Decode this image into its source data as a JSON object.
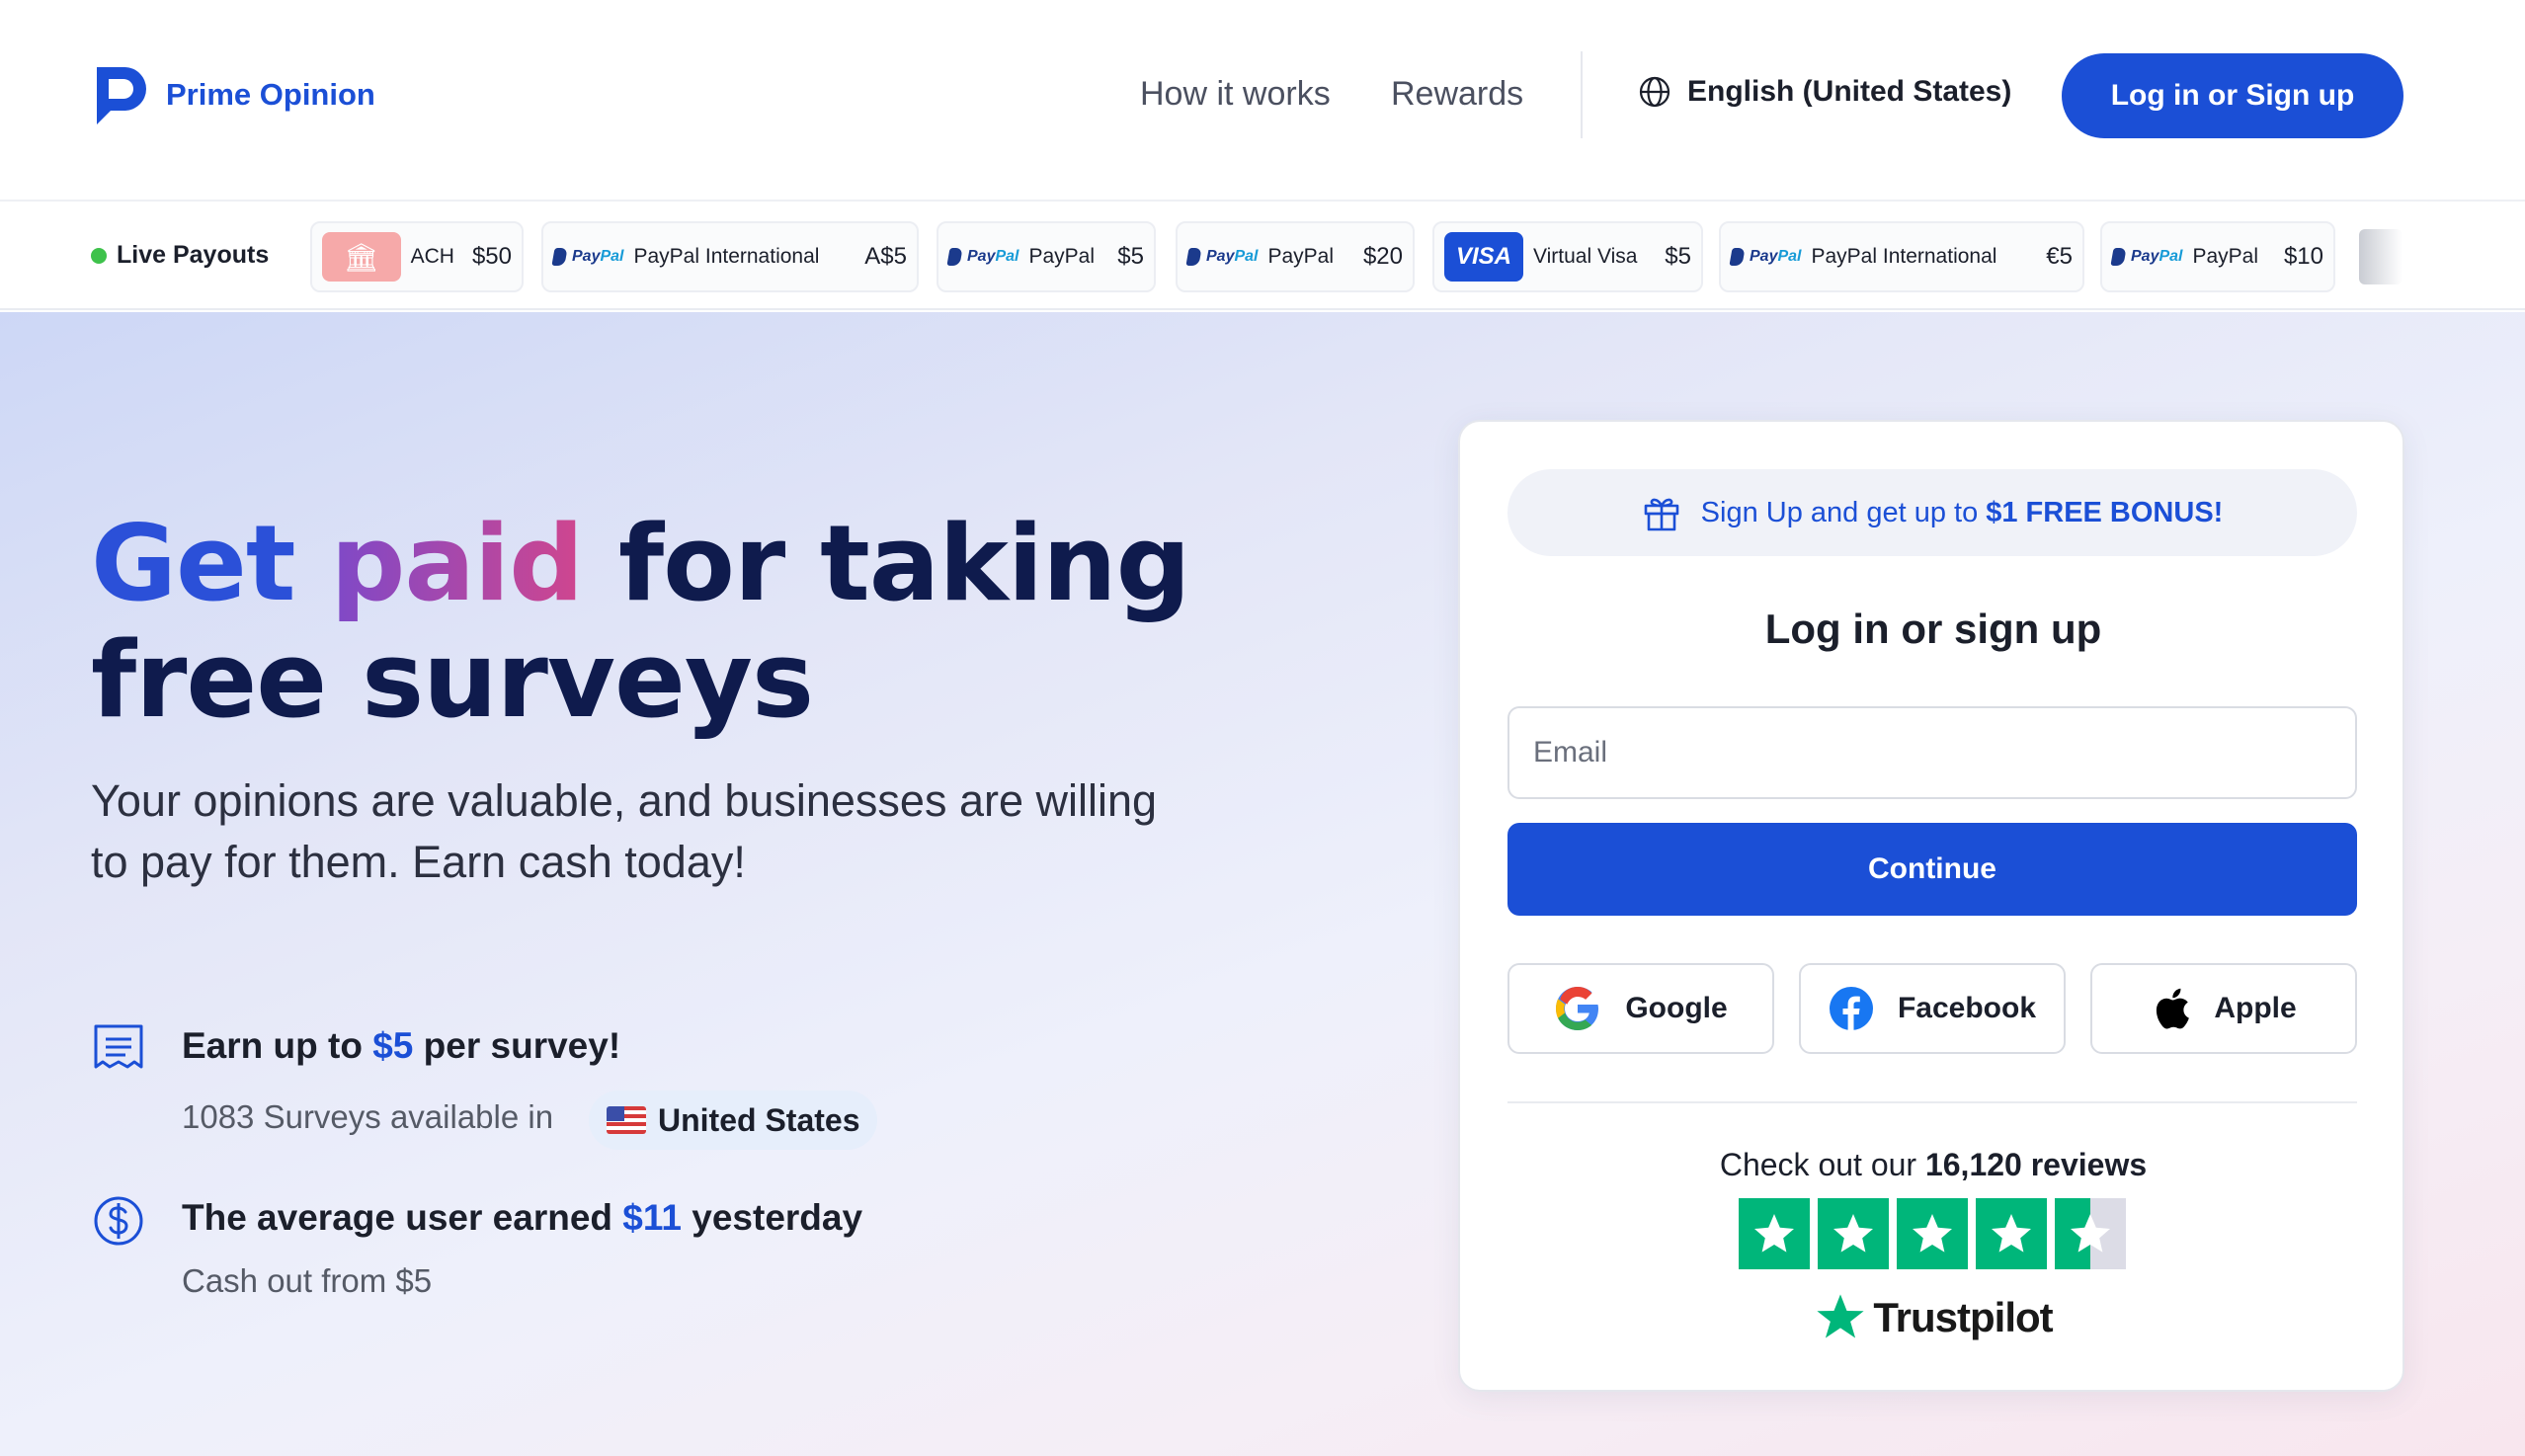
{
  "brand": {
    "name": "Prime Opinion",
    "color": "#1b4fd6"
  },
  "nav": {
    "links": [
      "How it works",
      "Rewards"
    ],
    "language": "English (United States)",
    "login_label": "Log in or Sign up"
  },
  "payouts": {
    "label": "Live Payouts",
    "items": [
      {
        "method": "ACH",
        "amount": "$50",
        "icon": "bank-icon"
      },
      {
        "method": "PayPal International",
        "amount": "A$5",
        "icon": "paypal-logo"
      },
      {
        "method": "PayPal",
        "amount": "$5",
        "icon": "paypal-logo"
      },
      {
        "method": "PayPal",
        "amount": "$20",
        "icon": "paypal-logo"
      },
      {
        "method": "Virtual Visa",
        "amount": "$5",
        "icon": "visa-logo"
      },
      {
        "method": "PayPal International",
        "amount": "€5",
        "icon": "paypal-logo"
      },
      {
        "method": "PayPal",
        "amount": "$10",
        "icon": "paypal-logo"
      }
    ],
    "paypal_text": {
      "pay": "Pay",
      "pal": "Pal"
    },
    "visa_text": "VISA"
  },
  "hero": {
    "headline_get": "Get",
    "headline_paid": "paid",
    "headline_rest1": "for taking",
    "headline_line2": "free surveys",
    "subtext": "Your opinions are valuable, and businesses are willing to pay for them. Earn cash today!"
  },
  "features": {
    "earn": {
      "pre": "Earn up to ",
      "highlight": "$5",
      "post": " per survey!",
      "icon": "receipt-icon"
    },
    "available_text": "1083 Surveys available in",
    "country": "United States",
    "average": {
      "pre": "The average user earned ",
      "highlight": "$11",
      "post": " yesterday",
      "icon": "dollar-circle-icon"
    },
    "cashout": "Cash out from $5"
  },
  "login_card": {
    "bonus_pre": "Sign Up and get up to",
    "bonus_highlight": "$1 FREE BONUS!",
    "title": "Log in or sign up",
    "email_placeholder": "Email",
    "email_value": "",
    "continue_label": "Continue",
    "social": [
      "Google",
      "Facebook",
      "Apple"
    ],
    "reviews_pre": "Check out our",
    "reviews_count": "16,120 reviews",
    "rating_stars": 4.5,
    "trustpilot": "Trustpilot"
  },
  "colors": {
    "primary": "#1b4fd6",
    "headline": "#0f1b4d",
    "live_dot": "#3ec24b",
    "trustpilot_green": "#00b67a"
  }
}
